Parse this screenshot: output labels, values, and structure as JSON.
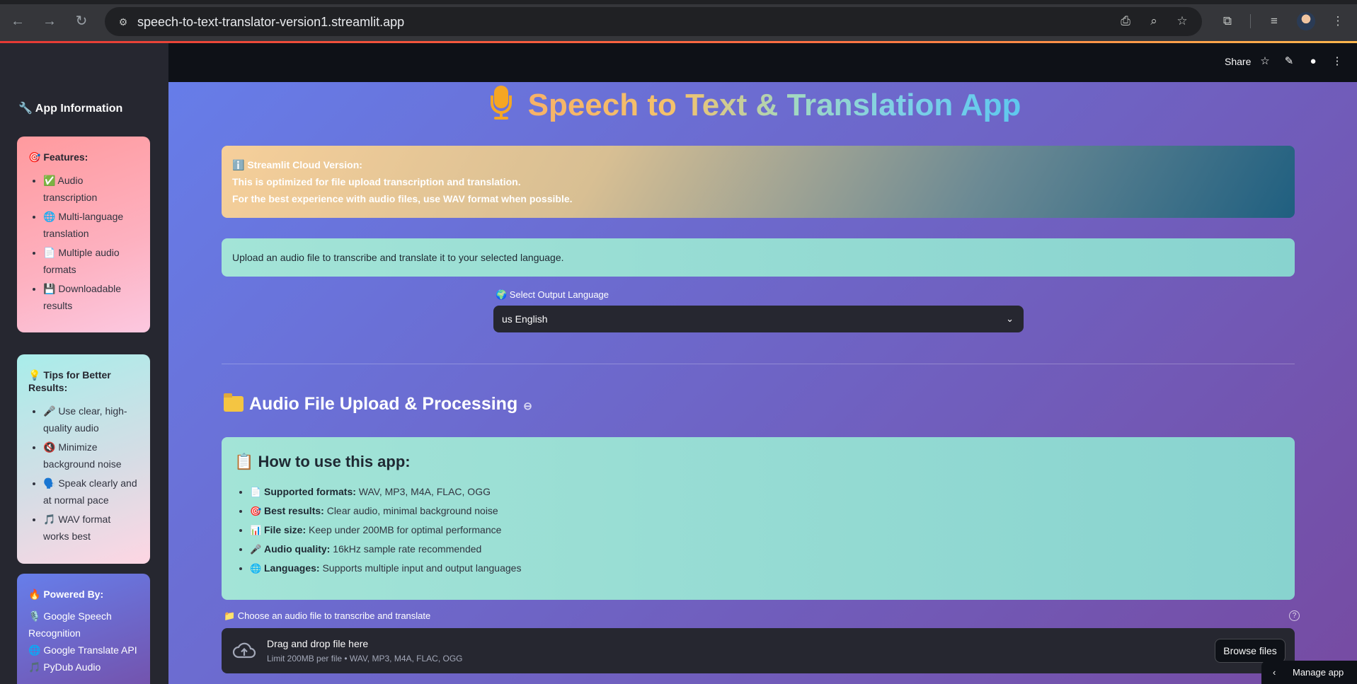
{
  "browser": {
    "url": "speech-to-text-translator-version1.streamlit.app"
  },
  "topbar": {
    "share": "Share"
  },
  "sidebar": {
    "title": "🔧 App Information",
    "features": {
      "heading": "🎯 Features:",
      "items": [
        "✅ Audio transcription",
        "🌐 Multi-language translation",
        "📄 Multiple audio formats",
        "💾 Downloadable results"
      ]
    },
    "tips": {
      "heading": "💡 Tips for Better Results:",
      "items": [
        "🎤 Use clear, high-quality audio",
        "🔇 Minimize background noise",
        "🗣️ Speak clearly and at normal pace",
        "🎵 WAV format works best"
      ]
    },
    "powered": {
      "heading": "🔥 Powered By:",
      "items": [
        "🎙️ Google Speech Recognition",
        "🌐 Google Translate API",
        "🎵 PyDub Audio"
      ]
    }
  },
  "main": {
    "title": "Speech to Text & Translation App",
    "info": {
      "line1": "ℹ️ Streamlit Cloud Version:",
      "line2": "This is optimized for file upload transcription and translation.",
      "line3": "For the best experience with audio files, use WAV format when possible."
    },
    "upload_note": "Upload an audio file to transcribe and translate it to your selected language.",
    "language": {
      "label": "🌍 Select Output Language",
      "value": "us English"
    },
    "section_heading": "Audio File Upload & Processing",
    "howto": {
      "heading": "📋 How to use this app:",
      "items": [
        {
          "emoji": "📄",
          "label": "Supported formats:",
          "text": " WAV, MP3, M4A, FLAC, OGG"
        },
        {
          "emoji": "🎯",
          "label": "Best results:",
          "text": " Clear audio, minimal background noise"
        },
        {
          "emoji": "📊",
          "label": "File size:",
          "text": " Keep under 200MB for optimal performance"
        },
        {
          "emoji": "🎤",
          "label": "Audio quality:",
          "text": " 16kHz sample rate recommended"
        },
        {
          "emoji": "🌐",
          "label": "Languages:",
          "text": " Supports multiple input and output languages"
        }
      ]
    },
    "uploader": {
      "label": "📁 Choose an audio file to transcribe and translate",
      "drag_text": "Drag and drop file here",
      "limit_text": "Limit 200MB per file • WAV, MP3, M4A, FLAC, OGG",
      "browse": "Browse files"
    },
    "manage_app": "Manage app"
  }
}
